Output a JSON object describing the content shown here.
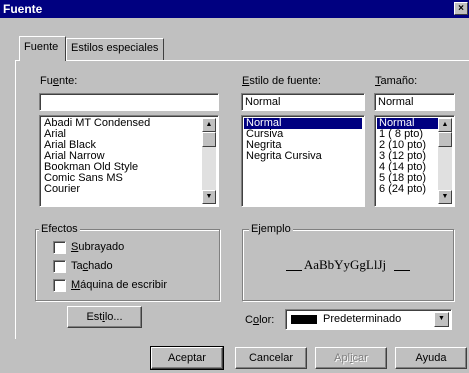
{
  "window": {
    "title": "Fuente",
    "close_glyph": "×"
  },
  "tabs": [
    {
      "label": "Fuente",
      "active": true
    },
    {
      "label": "Estilos especiales",
      "active": false
    }
  ],
  "font": {
    "label_pre": "Fu",
    "label_u": "e",
    "label_post": "nte:",
    "value": "",
    "items": [
      "Abadi MT Condensed",
      "Arial",
      "Arial Black",
      "Arial Narrow",
      "Bookman Old Style",
      "Comic Sans MS",
      "Courier"
    ]
  },
  "style": {
    "label_u": "E",
    "label_post": "stilo de fuente:",
    "value": "Normal",
    "items": [
      "Normal",
      "Cursiva",
      "Negrita",
      "Negrita Cursiva"
    ],
    "selected_index": 0
  },
  "size": {
    "label_u": "T",
    "label_post": "amaño:",
    "value": "Normal",
    "items": [
      "Normal",
      "1  ( 8 pto)",
      "2  (10 pto)",
      "3  (12 pto)",
      "4  (14 pto)",
      "5  (18 pto)",
      "6  (24 pto)"
    ],
    "selected_index": 0
  },
  "effects": {
    "title": "Efectos",
    "options": [
      {
        "pre": "",
        "u": "S",
        "post": "ubrayado",
        "checked": false
      },
      {
        "pre": "Ta",
        "u": "c",
        "post": "hado",
        "checked": false
      },
      {
        "pre": "",
        "u": "M",
        "post": "áquina de escribir",
        "checked": false
      }
    ]
  },
  "example": {
    "title": "Ejemplo",
    "sample": "AaBbYyGgLlJj"
  },
  "style_button": {
    "pre": "Est",
    "u": "i",
    "post": "lo..."
  },
  "color": {
    "label_pre": "C",
    "label_u": "o",
    "label_post": "lor:",
    "value": "Predeterminado",
    "swatch": "#000000"
  },
  "buttons": {
    "ok": "Aceptar",
    "cancel": "Cancelar",
    "apply_pre": "Apl",
    "apply_u": "i",
    "apply_post": "car",
    "help": "Ayuda"
  }
}
